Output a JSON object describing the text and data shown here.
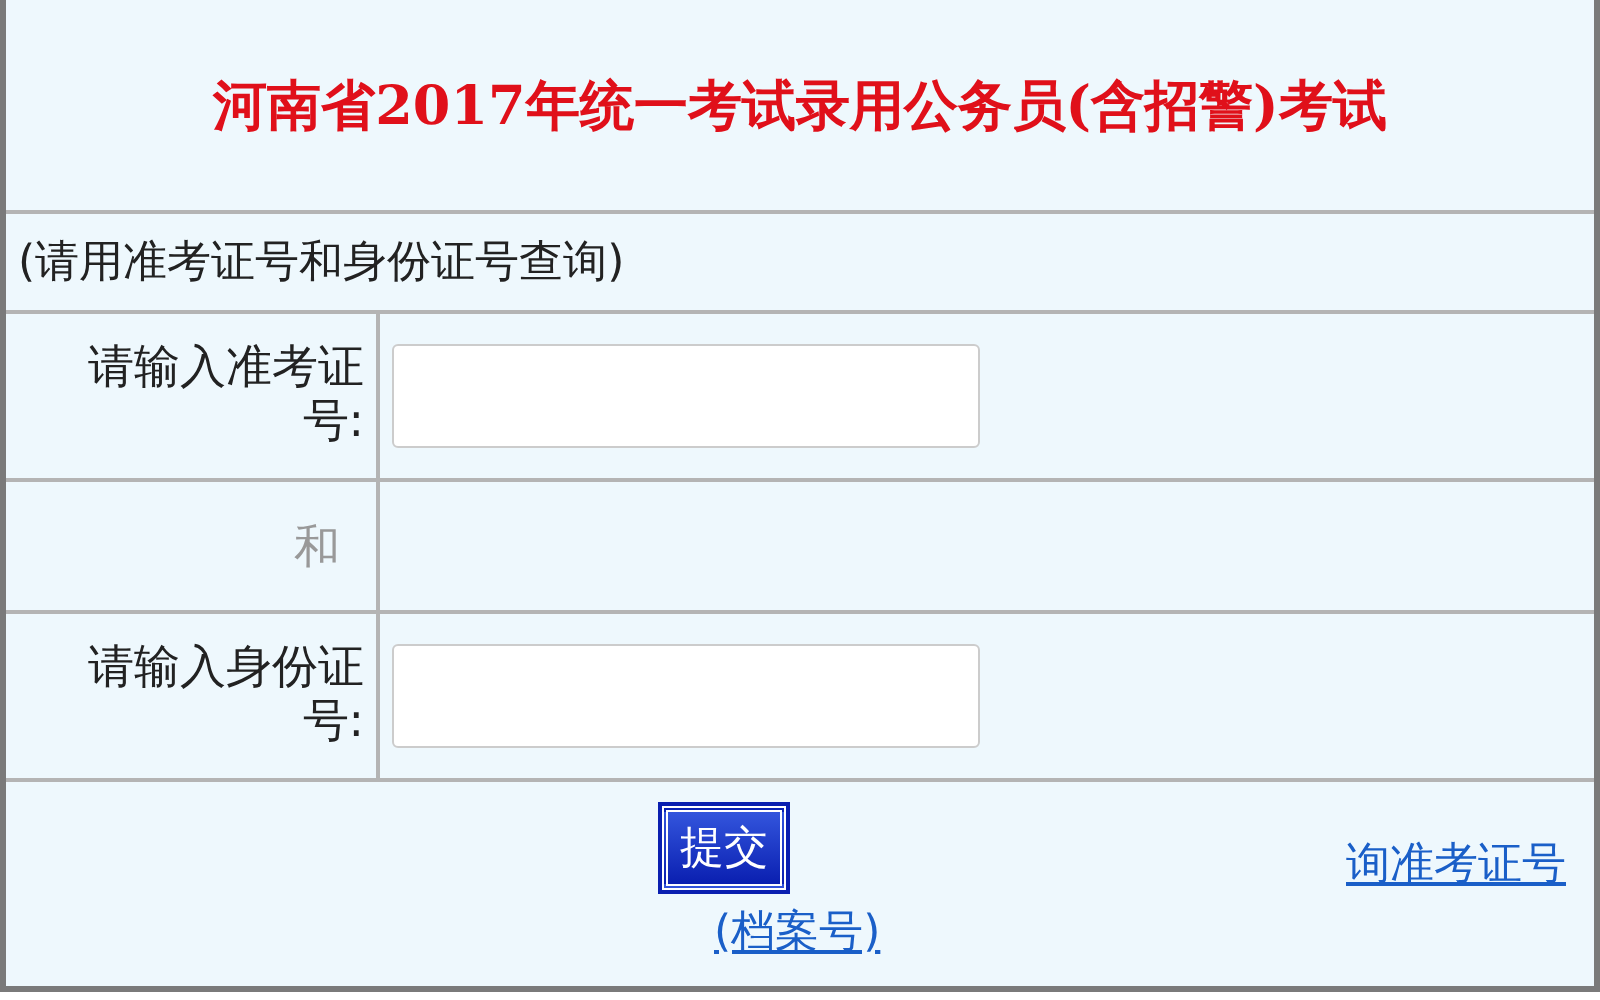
{
  "title": "河南省2017年统一考试录用公务员(含招警)考试",
  "hint": "(请用准考证号和身份证号查询)",
  "fields": [
    {
      "label": "请输入准考证号:",
      "kind": "input"
    },
    {
      "label": "和",
      "kind": "separator"
    },
    {
      "label": "请输入身份证号:",
      "kind": "input"
    }
  ],
  "submit": "提交",
  "links": [
    "询准考证号",
    "(档案号)"
  ]
}
